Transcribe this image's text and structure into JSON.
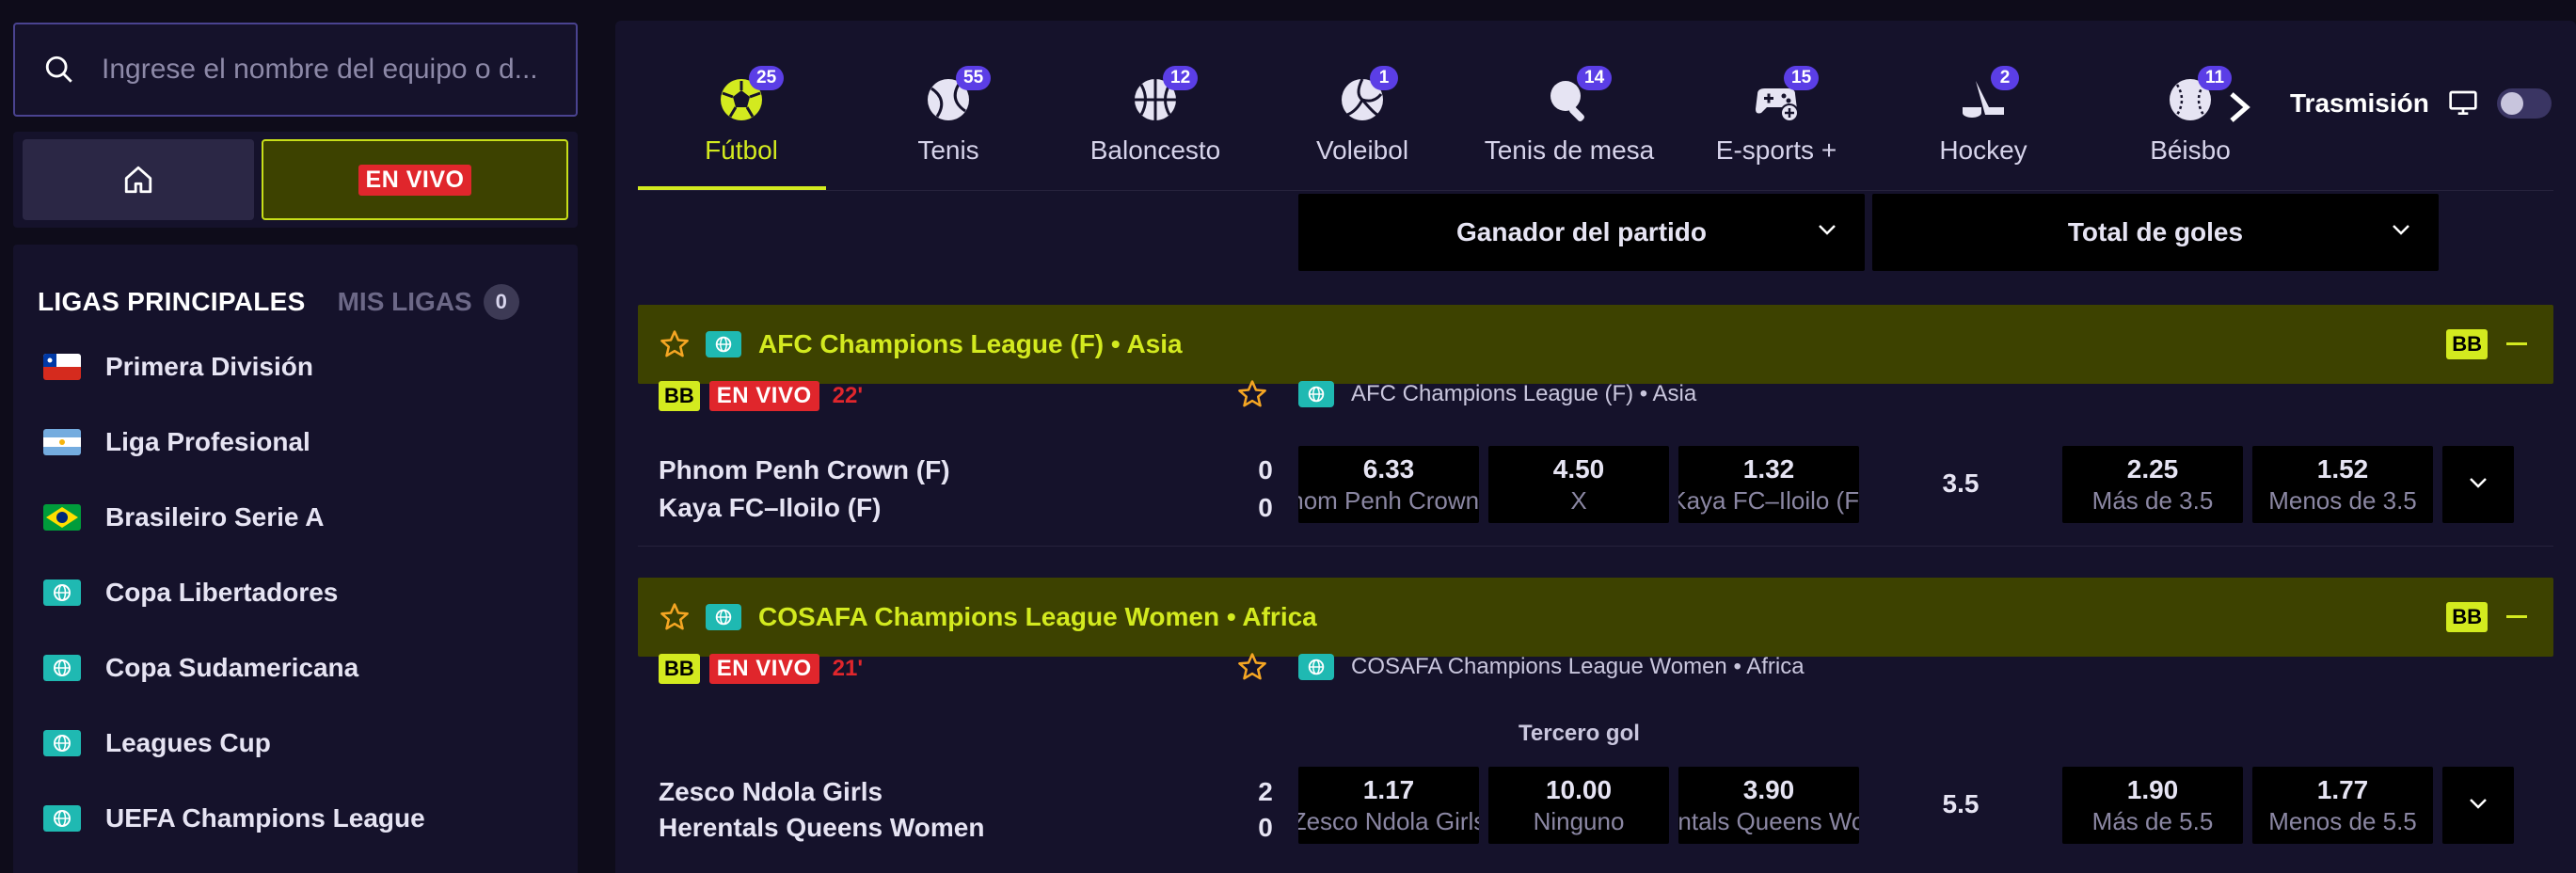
{
  "search": {
    "placeholder": "Ingrese el nombre del equipo o d..."
  },
  "mode": {
    "live_label": "EN VIVO"
  },
  "leagues_panel": {
    "tab_main": "LIGAS PRINCIPALES",
    "tab_mine": "MIS LIGAS",
    "mine_count": "0",
    "items": [
      {
        "label": "Primera División",
        "flag": "chile"
      },
      {
        "label": "Liga Profesional",
        "flag": "argentina"
      },
      {
        "label": "Brasileiro Serie A",
        "flag": "brazil"
      },
      {
        "label": "Copa Libertadores",
        "flag": "globe"
      },
      {
        "label": "Copa Sudamericana",
        "flag": "globe"
      },
      {
        "label": "Leagues Cup",
        "flag": "globe"
      },
      {
        "label": "UEFA Champions League",
        "flag": "globe"
      }
    ]
  },
  "sports": [
    {
      "name": "Fútbol",
      "count": "25",
      "icon": "soccer-ball-icon",
      "active": true
    },
    {
      "name": "Tenis",
      "count": "55",
      "icon": "tennis-ball-icon"
    },
    {
      "name": "Baloncesto",
      "count": "12",
      "icon": "basketball-icon"
    },
    {
      "name": "Voleibol",
      "count": "1",
      "icon": "volleyball-icon"
    },
    {
      "name": "Tenis de mesa",
      "count": "14",
      "icon": "table-tennis-icon"
    },
    {
      "name": "E-sports +",
      "count": "15",
      "icon": "gamepad-icon"
    },
    {
      "name": "Hockey",
      "count": "2",
      "icon": "hockey-icon"
    },
    {
      "name": "Béisbo",
      "count": "11",
      "icon": "baseball-icon"
    }
  ],
  "stream": {
    "label": "Trasmisión"
  },
  "markets": {
    "first": "Ganador del partido",
    "second": "Total de goles"
  },
  "events": [
    {
      "league": "AFC Champions League (F) • Asia",
      "bb": "BB",
      "live": "EN VIVO",
      "minute": "22'",
      "home": "Phnom Penh Crown (F)",
      "away": "Kaya FC–Iloilo (F)",
      "home_score": "0",
      "away_score": "0",
      "sub_label": "",
      "odds": [
        {
          "value": "6.33",
          "label": "Phnom Penh Crown (F)"
        },
        {
          "value": "4.50",
          "label": "X"
        },
        {
          "value": "1.32",
          "label": "Kaya FC–Iloilo (F)"
        }
      ],
      "line": "3.5",
      "totals": [
        {
          "value": "2.25",
          "label": "Más de 3.5"
        },
        {
          "value": "1.52",
          "label": "Menos de 3.5"
        }
      ]
    },
    {
      "league": "COSAFA Champions League Women • Africa",
      "bb": "BB",
      "live": "EN VIVO",
      "minute": "21'",
      "home": "Zesco Ndola Girls",
      "away": "Herentals Queens Women",
      "home_score": "2",
      "away_score": "0",
      "sub_label": "Tercero gol",
      "odds": [
        {
          "value": "1.17",
          "label": "Zesco Ndola Girls"
        },
        {
          "value": "10.00",
          "label": "Ninguno"
        },
        {
          "value": "3.90",
          "label": "Herentals Queens Women"
        }
      ],
      "line": "5.5",
      "totals": [
        {
          "value": "1.90",
          "label": "Más de 5.5"
        },
        {
          "value": "1.77",
          "label": "Menos de 5.5"
        }
      ]
    }
  ],
  "colors": {
    "accent": "#d3ea1f",
    "live": "#e0262c",
    "badge": "#5b3ee6",
    "panel": "#15122b"
  }
}
